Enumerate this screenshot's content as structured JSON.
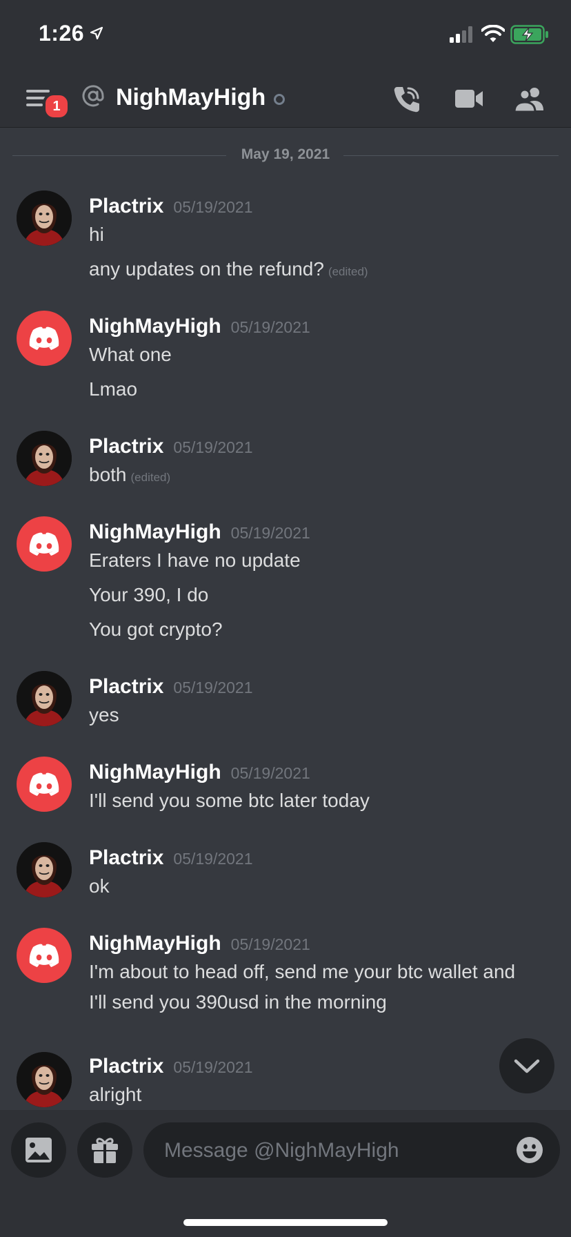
{
  "status_bar": {
    "time": "1:26"
  },
  "header": {
    "unread_badge": "1",
    "channel_name": "NighMayHigh"
  },
  "date_divider": "May 19, 2021",
  "messages": [
    {
      "author": "Plactrix",
      "timestamp": "05/19/2021",
      "avatar": "profile-picture",
      "lines": [
        {
          "text": "hi"
        },
        {
          "text": "any updates on the refund?",
          "edited": "(edited)"
        }
      ]
    },
    {
      "author": "NighMayHigh",
      "timestamp": "05/19/2021",
      "avatar": "discord-logo",
      "lines": [
        {
          "text": "What one"
        },
        {
          "text": "Lmao"
        }
      ]
    },
    {
      "author": "Plactrix",
      "timestamp": "05/19/2021",
      "avatar": "profile-picture",
      "lines": [
        {
          "text": "both",
          "edited": "(edited)"
        }
      ]
    },
    {
      "author": "NighMayHigh",
      "timestamp": "05/19/2021",
      "avatar": "discord-logo",
      "lines": [
        {
          "text": "Eraters I have no update"
        },
        {
          "text": "Your 390, I do"
        },
        {
          "text": "You got crypto?"
        }
      ]
    },
    {
      "author": "Plactrix",
      "timestamp": "05/19/2021",
      "avatar": "profile-picture",
      "lines": [
        {
          "text": "yes"
        }
      ]
    },
    {
      "author": "NighMayHigh",
      "timestamp": "05/19/2021",
      "avatar": "discord-logo",
      "lines": [
        {
          "text": "I'll send you some btc later today"
        }
      ]
    },
    {
      "author": "Plactrix",
      "timestamp": "05/19/2021",
      "avatar": "profile-picture",
      "lines": [
        {
          "text": "ok"
        }
      ]
    },
    {
      "author": "NighMayHigh",
      "timestamp": "05/19/2021",
      "avatar": "discord-logo",
      "lines": [
        {
          "text": "I'm about to head off, send me your btc wallet and"
        },
        {
          "text": "I'll send you 390usd in the morning"
        }
      ]
    },
    {
      "author": "Plactrix",
      "timestamp": "05/19/2021",
      "avatar": "profile-picture",
      "lines": [
        {
          "text": "alright"
        }
      ]
    }
  ],
  "composer": {
    "placeholder": "Message @NighMayHigh"
  },
  "icons": {
    "header": [
      "hamburger-menu-icon",
      "at-icon",
      "call-icon",
      "video-icon",
      "members-icon"
    ],
    "composer": [
      "image-icon",
      "gift-icon",
      "emoji-icon"
    ],
    "scroll": "chevron-down-icon"
  },
  "colors": {
    "background": "#36393f",
    "header": "#2f3136",
    "badge": "#ed4245",
    "discord_avatar": "#ed4245",
    "battery": "#3ba55d"
  }
}
